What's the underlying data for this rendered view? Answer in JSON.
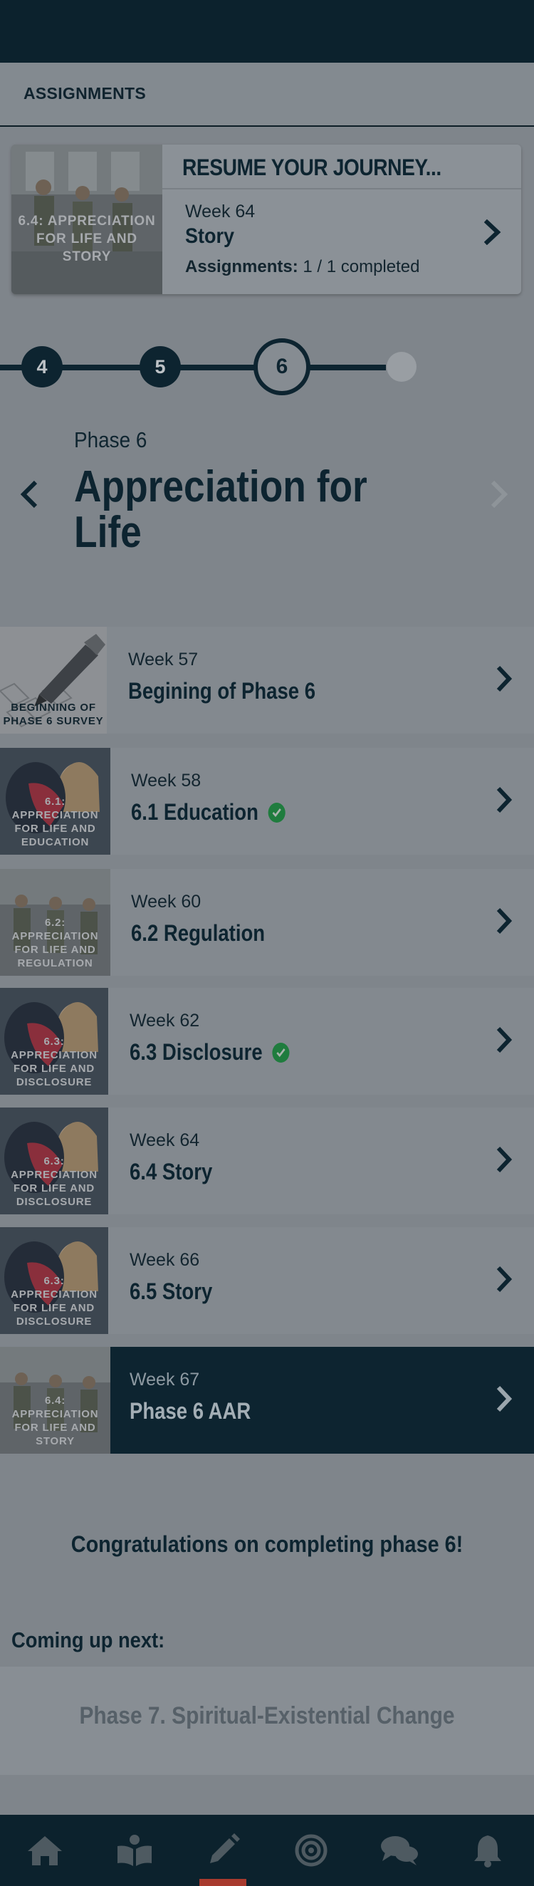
{
  "section": {
    "title": "ASSIGNMENTS"
  },
  "resume": {
    "heading": "RESUME YOUR JOURNEY...",
    "thumb_caption": "6.4: APPRECIATION FOR LIFE AND STORY",
    "week": "Week 64",
    "name": "Story",
    "assignments_label": "Assignments:",
    "assignments_value": "1 / 1 completed"
  },
  "stepper": {
    "steps": [
      "4",
      "5",
      "6"
    ],
    "current": "6"
  },
  "phase": {
    "label": "Phase 6",
    "title": "Appreciation for Life"
  },
  "weeks": [
    {
      "week": "Week 57",
      "name": "Begining of Phase 6",
      "caption": "BEGINNING OF PHASE 6 SURVEY",
      "completed": false,
      "active": false
    },
    {
      "week": "Week 58",
      "name": "6.1  Education",
      "caption": "6.1: APPRECIATION FOR LIFE AND EDUCATION",
      "completed": true,
      "active": false
    },
    {
      "week": "Week 60",
      "name": "6.2  Regulation",
      "caption": "6.2: APPRECIATION FOR LIFE AND REGULATION",
      "completed": false,
      "active": false
    },
    {
      "week": "Week 62",
      "name": "6.3  Disclosure",
      "caption": "6.3: APPRECIATION FOR LIFE AND DISCLOSURE",
      "completed": true,
      "active": false
    },
    {
      "week": "Week 64",
      "name": "6.4  Story",
      "caption": "6.3: APPRECIATION FOR LIFE AND DISCLOSURE",
      "completed": false,
      "active": false
    },
    {
      "week": "Week 66",
      "name": "6.5  Story",
      "caption": "6.3: APPRECIATION FOR LIFE AND DISCLOSURE",
      "completed": false,
      "active": false
    },
    {
      "week": "Week 67",
      "name": "Phase 6 AAR",
      "caption": "6.4: APPRECIATION FOR LIFE AND STORY",
      "completed": false,
      "active": true
    }
  ],
  "congrats": "Congratulations on completing phase 6!",
  "coming_up": {
    "label": "Coming up next:",
    "next": "Phase 7. Spiritual-Existential Change"
  },
  "tabbar": {
    "tabs": [
      "home-icon",
      "book-icon",
      "pencil-icon",
      "target-icon",
      "chat-icon",
      "bell-icon"
    ],
    "active": "pencil-icon",
    "accent": "#a83a2e"
  },
  "colors": {
    "navy": "#0d2430",
    "overlay_bg": "#7f858b",
    "check_green": "#1f7c3e"
  }
}
